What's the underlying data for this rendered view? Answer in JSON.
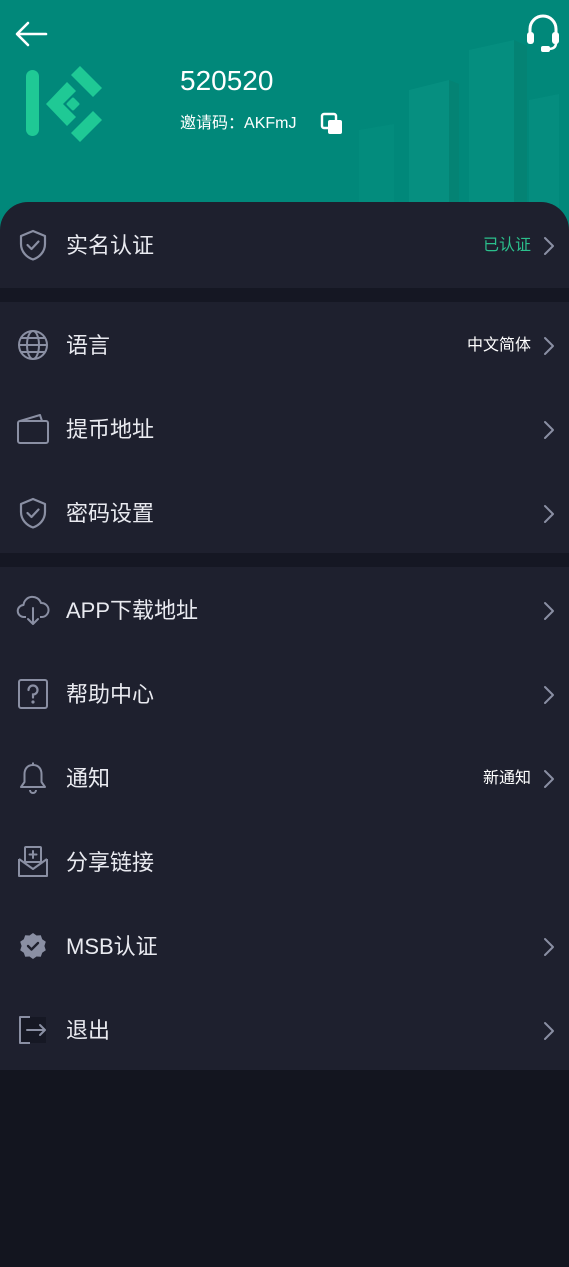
{
  "header": {
    "username": "520520",
    "invite_label": "邀请码：",
    "invite_code": "AKFmJ",
    "icons": {
      "back": "back-arrow-icon",
      "support": "headset-icon",
      "logo": "kucoin-logo-icon",
      "copy": "copy-icon"
    }
  },
  "menu": {
    "group1": [
      {
        "label": "实名认证",
        "value": "已认证",
        "icon": "shield-icon",
        "chevron": true
      }
    ],
    "group2": [
      {
        "label": "语言",
        "value": "中文简体",
        "icon": "globe-icon",
        "chevron": true
      },
      {
        "label": "提币地址",
        "value": "",
        "icon": "wallet-icon",
        "chevron": true
      },
      {
        "label": "密码设置",
        "value": "",
        "icon": "shield-check-icon",
        "chevron": true
      }
    ],
    "group3": [
      {
        "label": "APP下载地址",
        "value": "",
        "icon": "cloud-download-icon",
        "chevron": true
      },
      {
        "label": "帮助中心",
        "value": "",
        "icon": "help-icon",
        "chevron": true
      },
      {
        "label": "通知",
        "value": "新通知",
        "icon": "bell-icon",
        "chevron": true
      },
      {
        "label": "分享链接",
        "value": "",
        "icon": "share-icon",
        "chevron": false
      },
      {
        "label": "MSB认证",
        "value": "",
        "icon": "badge-icon",
        "chevron": true
      },
      {
        "label": "退出",
        "value": "",
        "icon": "logout-icon",
        "chevron": true
      }
    ]
  },
  "colors": {
    "header_bg": "#01887a",
    "panel_bg": "#1e202e",
    "page_bg": "#13151f",
    "verified_green": "#2bbf8c",
    "icon_gray": "#8a8fa3"
  }
}
